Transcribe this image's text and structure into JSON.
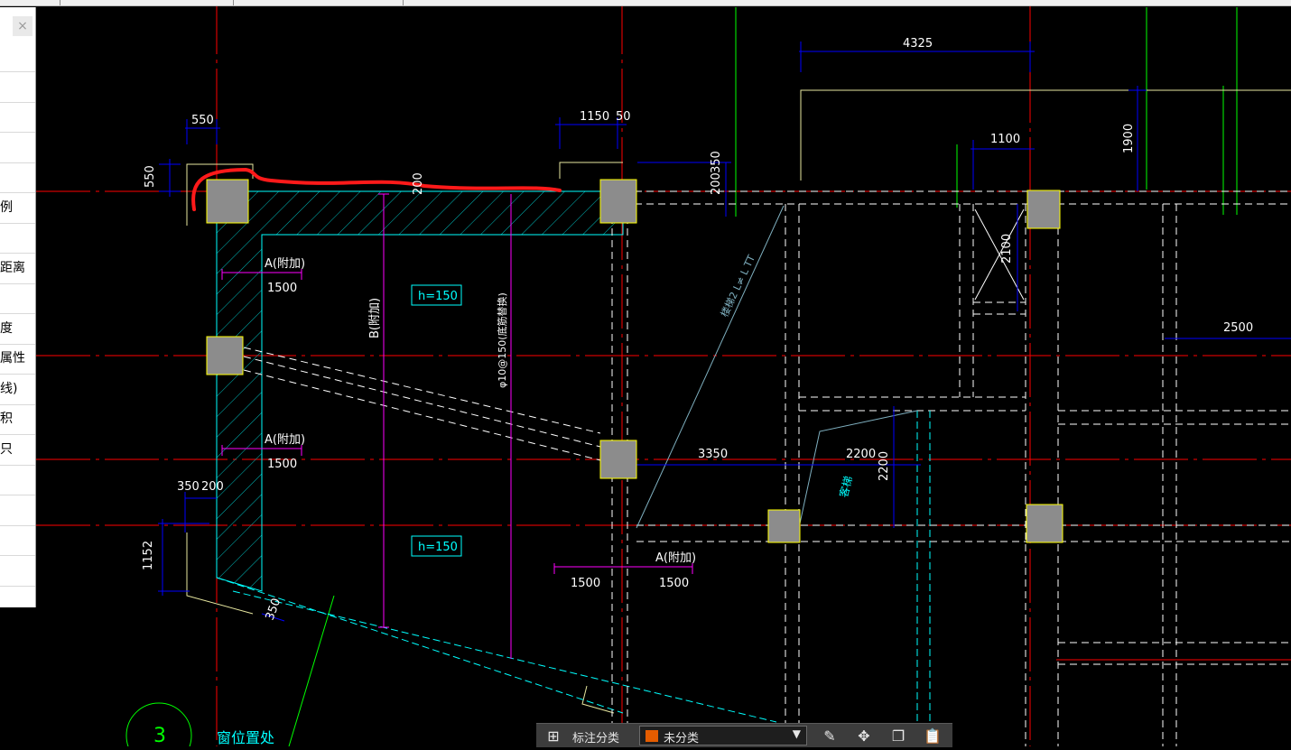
{
  "side_panel": {
    "close_label": "×",
    "rows": [
      "",
      "",
      "",
      "",
      "",
      "例",
      "",
      "距离",
      "",
      "度",
      "属性",
      "线)",
      "积",
      "只",
      "",
      "",
      "",
      "",
      ""
    ]
  },
  "toolbar": {
    "category_label": "标注分类",
    "category_value": "未分类",
    "category_color": "#e45c00"
  },
  "drawing": {
    "dimensions": {
      "d4325": "4325",
      "d550_top": "550",
      "d550_left": "550",
      "d1150": "1150",
      "d50": "50",
      "d200": "200",
      "d350_top": "350",
      "d1100": "1100",
      "d1900": "1900",
      "d2100": "2100",
      "d2500": "2500",
      "d3350": "3350",
      "d2200_h": "2200",
      "d2200_v": "2200",
      "d350_left": "350",
      "d200_left": "200",
      "d1152": "1152",
      "d350_bottom": "350",
      "d1500_a": "1500",
      "d1500_b": "1500",
      "d1500_c": "1500",
      "d1500_d": "1500"
    },
    "labels": {
      "rebar_a1": "A(附加)",
      "rebar_a2": "A(附加)",
      "rebar_a3": "A(附加)",
      "rebar_b": "B(附加)",
      "rebar_main": "φ10@150(底筋替换)",
      "thickness_1": "h=150",
      "thickness_2": "h=150",
      "room": "客梯",
      "stair": "楼梯2 L≠ L TT",
      "slab_note": "200",
      "axis_number": "3",
      "window_note": "窗位置处"
    },
    "colors": {
      "axis": "#ff0000",
      "dimension": "#0000ff",
      "wall": "#00ffff",
      "rebar": "#ff00ff",
      "column": "#808080",
      "green_line": "#00ff00",
      "yellow": "#ffff00",
      "markup": "#ff1a1a"
    }
  }
}
